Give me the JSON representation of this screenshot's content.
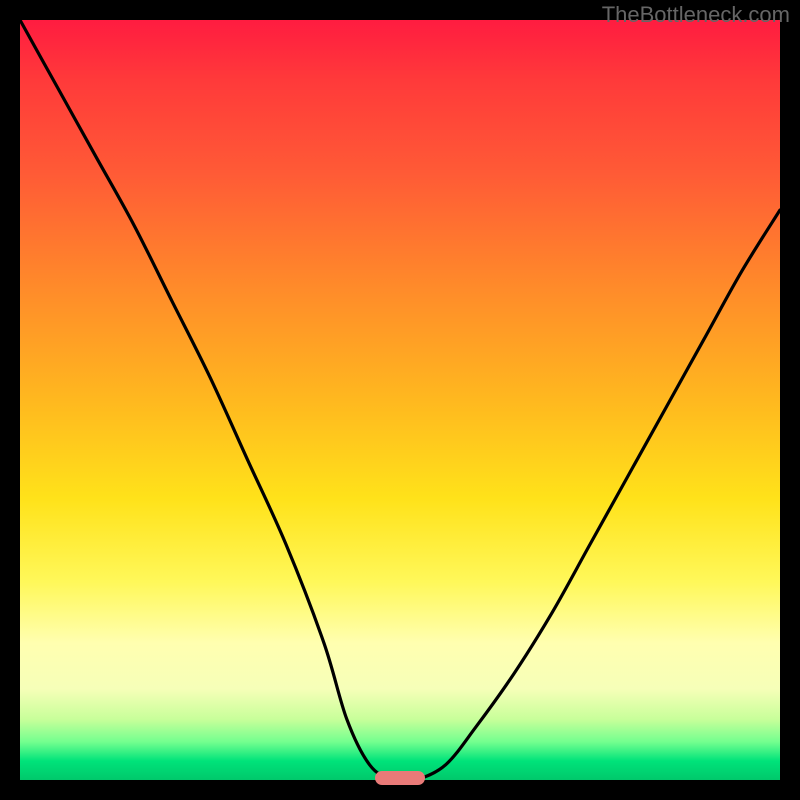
{
  "watermark": "TheBottleneck.com",
  "colors": {
    "frame": "#000000",
    "curve_stroke": "#000000",
    "marker_fill": "#e97a78"
  },
  "chart_data": {
    "type": "line",
    "title": "",
    "xlabel": "",
    "ylabel": "",
    "xlim": [
      0,
      100
    ],
    "ylim": [
      0,
      100
    ],
    "gradient_meaning": "background color maps y-value: top (red) = high bottleneck, bottom (green) = low bottleneck",
    "series": [
      {
        "name": "bottleneck-curve",
        "x": [
          0,
          5,
          10,
          15,
          20,
          25,
          30,
          35,
          40,
          43,
          46,
          49,
          52,
          56,
          60,
          65,
          70,
          75,
          80,
          85,
          90,
          95,
          100
        ],
        "y": [
          100,
          91,
          82,
          73,
          63,
          53,
          42,
          31,
          18,
          8,
          2,
          0,
          0,
          2,
          7,
          14,
          22,
          31,
          40,
          49,
          58,
          67,
          75
        ]
      }
    ],
    "annotations": [
      {
        "name": "minimum-marker",
        "x": 50,
        "y": 0,
        "shape": "pill",
        "color": "#e97a78"
      }
    ]
  }
}
